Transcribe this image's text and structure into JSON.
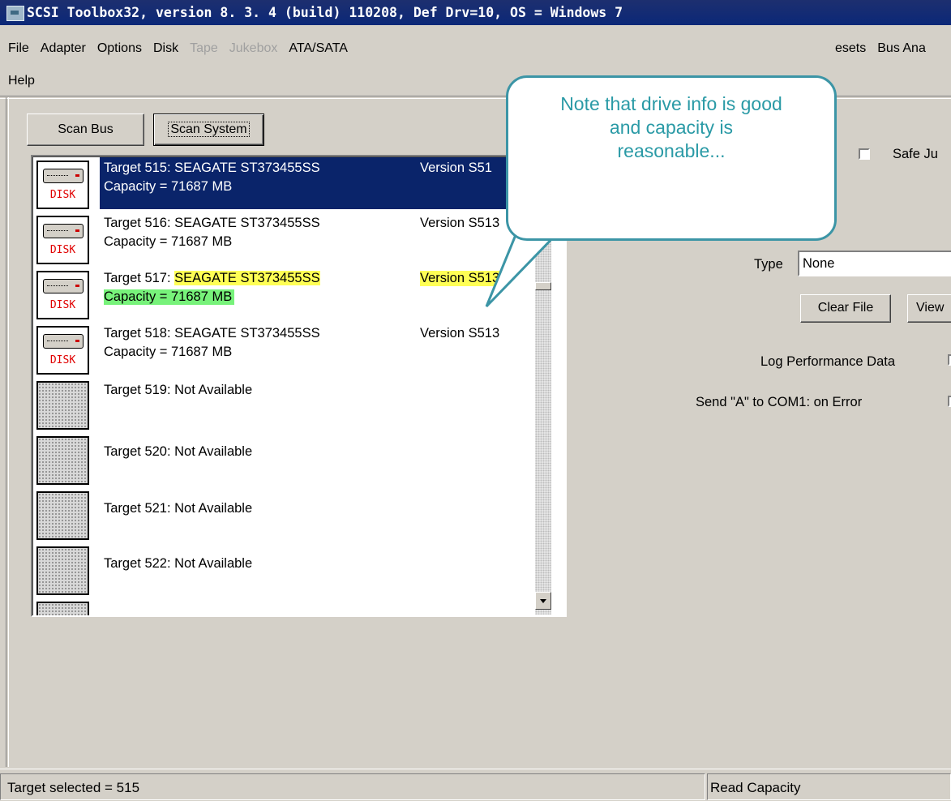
{
  "window": {
    "title": "SCSI Toolbox32, version 8. 3. 4 (build) 110208, Def Drv=10, OS = Windows 7"
  },
  "menu": {
    "row1": [
      {
        "label": "File",
        "enabled": true
      },
      {
        "label": "Adapter",
        "enabled": true
      },
      {
        "label": "Options",
        "enabled": true
      },
      {
        "label": "Disk",
        "enabled": true
      },
      {
        "label": "Tape",
        "enabled": false
      },
      {
        "label": "Jukebox",
        "enabled": false
      },
      {
        "label": "ATA/SATA",
        "enabled": true
      },
      {
        "label": "esets",
        "enabled": true
      },
      {
        "label": "Bus Ana",
        "enabled": true
      }
    ],
    "row2": [
      {
        "label": "Help",
        "enabled": true
      }
    ]
  },
  "toolbar": {
    "scan_bus_label": "Scan Bus",
    "scan_system_label": "Scan System"
  },
  "targets": [
    {
      "line1": "Target 515: SEAGATE  ST373455SS",
      "version": "Version S51",
      "line2": "Capacity = 71687 MB",
      "icon": "disk-drive-icon",
      "icon_label": "DISK",
      "selected": true
    },
    {
      "line1": "Target 516: SEAGATE  ST373455SS",
      "version": "Version S513",
      "line2": "Capacity = 71687 MB",
      "icon": "disk-drive-icon",
      "icon_label": "DISK"
    },
    {
      "line1_prefix": "Target 517: ",
      "line1_highlight": "SEAGATE  ST373455SS",
      "version": "Version S513",
      "line2": "Capacity = 71687 MB",
      "icon": "disk-drive-icon",
      "icon_label": "DISK",
      "highlighted": true
    },
    {
      "line1": "Target 518: SEAGATE  ST373455SS",
      "version": "Version S513",
      "line2": "Capacity = 71687 MB",
      "icon": "disk-drive-icon",
      "icon_label": "DISK"
    },
    {
      "line1": "Target 519: Not Available",
      "icon": "unavailable-icon"
    },
    {
      "line1": "Target 520: Not Available",
      "icon": "unavailable-icon"
    },
    {
      "line1": "Target 521: Not Available",
      "icon": "unavailable-icon"
    },
    {
      "line1": "Target 522: Not Available",
      "icon": "unavailable-icon"
    }
  ],
  "right_panel": {
    "safe_label": "Safe Ju",
    "safe_checked": false,
    "type_label": "Type",
    "type_value": "None",
    "clear_file_label": "Clear File",
    "view_label": "View",
    "log_perf_label": "Log Performance Data",
    "send_a_label": "Send \"A\" to COM1: on Error"
  },
  "callout": {
    "text": "Note that drive info is good and capacity is reasonable...",
    "color": "#2a9aa6",
    "border": "#3c95a6"
  },
  "status": {
    "left": "Target selected = 515",
    "right": "Read Capacity"
  },
  "colors": {
    "selection": "#0a246a",
    "highlight_yellow": "#ffff55",
    "highlight_green": "#77f27a",
    "titlebar": "#0b2878"
  }
}
